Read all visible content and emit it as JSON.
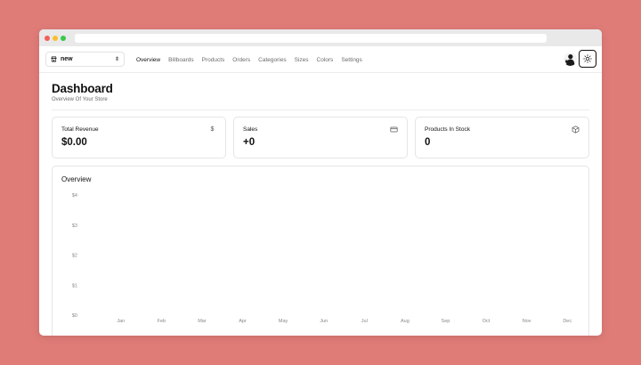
{
  "store_switcher": {
    "name": "new",
    "icon": "store-icon"
  },
  "nav": {
    "links": [
      {
        "label": "Overview",
        "active": true
      },
      {
        "label": "Billboards",
        "active": false
      },
      {
        "label": "Products",
        "active": false
      },
      {
        "label": "Orders",
        "active": false
      },
      {
        "label": "Categories",
        "active": false
      },
      {
        "label": "Sizes",
        "active": false
      },
      {
        "label": "Colors",
        "active": false
      },
      {
        "label": "Settings",
        "active": false
      }
    ]
  },
  "page": {
    "title": "Dashboard",
    "subtitle": "Overview Of Your Store"
  },
  "cards": [
    {
      "title": "Total Revenue",
      "value": "$0.00",
      "icon": "dollar-icon"
    },
    {
      "title": "Sales",
      "value": "+0",
      "icon": "credit-card-icon"
    },
    {
      "title": "Products In Stock",
      "value": "0",
      "icon": "package-icon"
    }
  ],
  "overview": {
    "title": "Overview"
  },
  "chart_data": {
    "type": "bar",
    "categories": [
      "Jan",
      "Feb",
      "Mar",
      "Apr",
      "May",
      "Jun",
      "Jul",
      "Aug",
      "Sep",
      "Oct",
      "Nov",
      "Dec"
    ],
    "values": [
      0,
      0,
      0,
      0,
      0,
      0,
      0,
      0,
      0,
      0,
      0,
      0
    ],
    "yticks": [
      "$0",
      "$1",
      "$2",
      "$3",
      "$4"
    ],
    "ylim": [
      0,
      4
    ],
    "grid": false,
    "title": "",
    "xlabel": "",
    "ylabel": ""
  }
}
